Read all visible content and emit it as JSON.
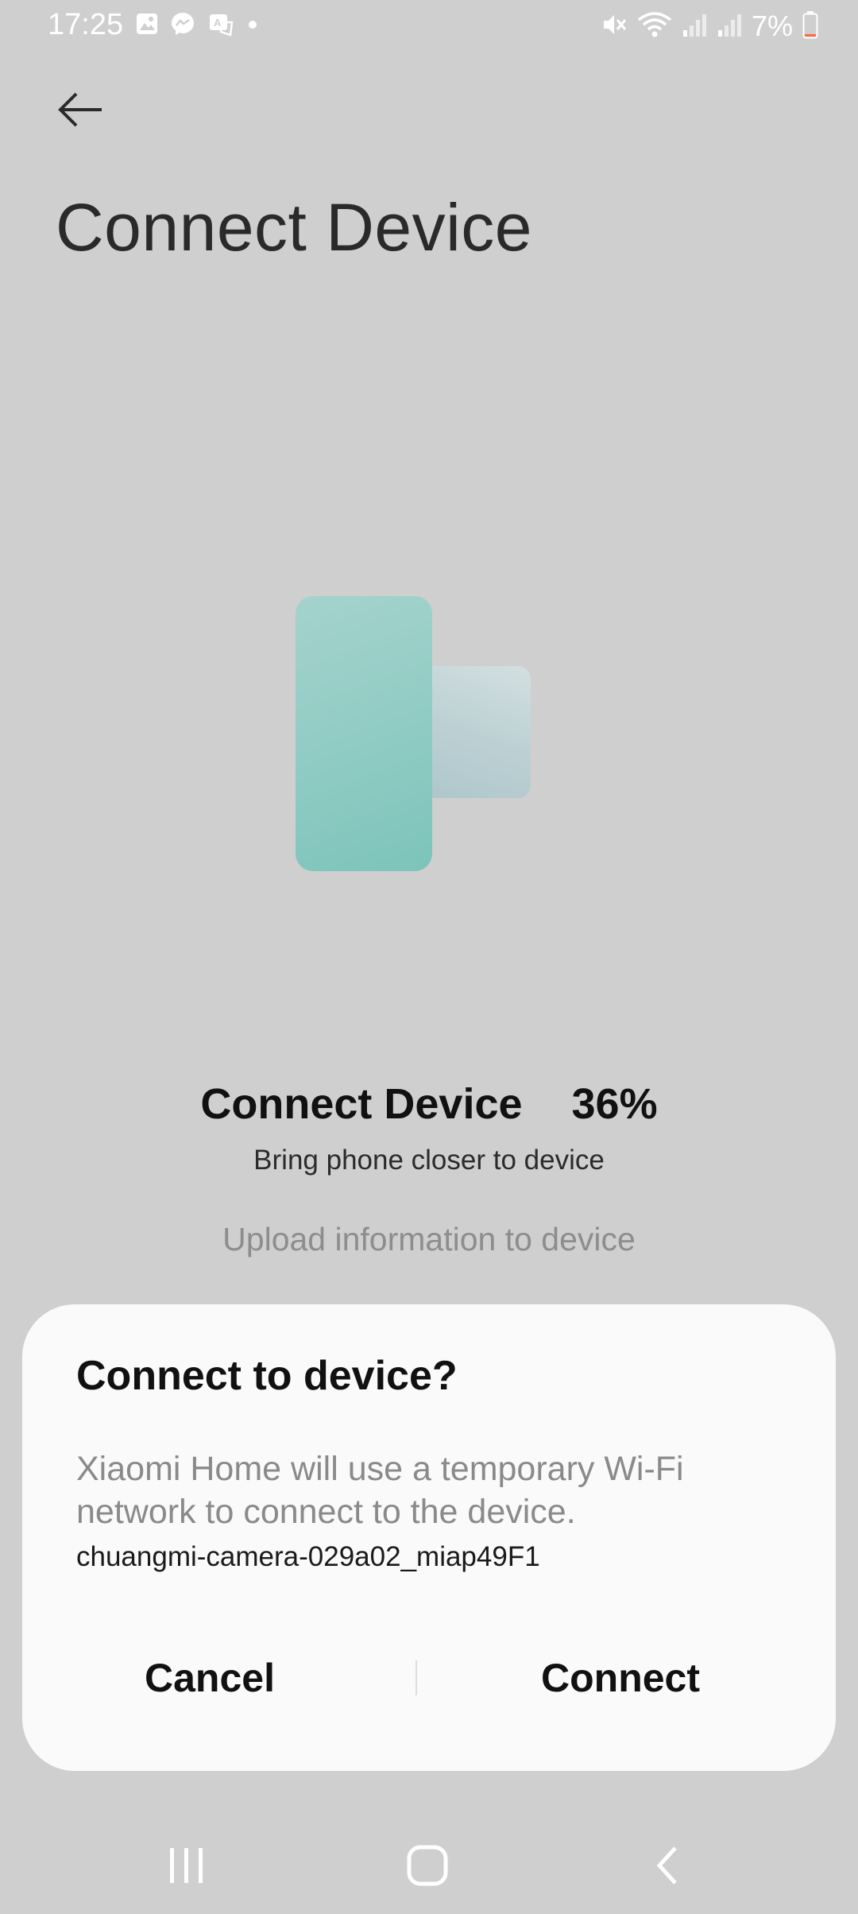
{
  "status_bar": {
    "time": "17:25",
    "battery_text": "7%",
    "left_icons": [
      "gallery-icon",
      "messenger-icon",
      "translate-icon",
      "dot-icon"
    ],
    "right_icons": [
      "mute-icon",
      "wifi-icon",
      "signal-icon",
      "signal-icon",
      "battery-icon"
    ],
    "battery_level_percent": 7,
    "battery_low_color": "#ff6a3d"
  },
  "header": {
    "back_icon": "arrow-left-icon",
    "title": "Connect Device"
  },
  "progress": {
    "label": "Connect Device",
    "percent": "36%",
    "subtitle": "Bring phone closer to device",
    "current_step": "Upload information to device"
  },
  "illustration": {
    "accent_color": "#8fcbc3",
    "device_color": "#bdd1d4"
  },
  "dialog": {
    "title": "Connect to device?",
    "message": "Xiaomi Home will use a temporary Wi-Fi network to connect to the device.",
    "network_name": "chuangmi-camera-029a02_miap49F1",
    "cancel_label": "Cancel",
    "connect_label": "Connect"
  },
  "nav_bar": {
    "buttons": [
      "recents-icon",
      "home-icon",
      "back-icon"
    ]
  }
}
